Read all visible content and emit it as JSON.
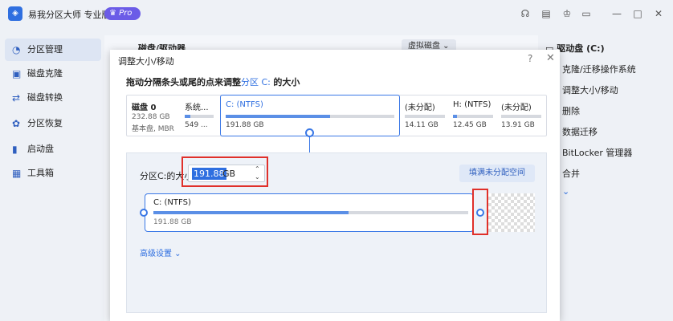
{
  "app": {
    "title": "易我分区大师 专业版",
    "badge": "Pro"
  },
  "sidebar": {
    "items": [
      {
        "label": "分区管理",
        "active": true
      },
      {
        "label": "磁盘克隆"
      },
      {
        "label": "磁盘转换"
      },
      {
        "label": "分区恢复"
      },
      {
        "label": "启动盘"
      },
      {
        "label": "工具箱"
      }
    ]
  },
  "main": {
    "title": "磁盘/驱动器",
    "virtual_disk": "虚拟磁盘"
  },
  "right_panel": {
    "title": "驱动盘 (C:)",
    "items": [
      "克隆/迁移操作系统",
      "调整大小/移动",
      "删除",
      "数据迁移",
      "BitLocker 管理器",
      "合并"
    ]
  },
  "dialog": {
    "title": "调整大小/移动",
    "instruction_prefix": "拖动分隔条头或尾的点来调整",
    "instruction_highlight": "分区 C:",
    "instruction_suffix": "的大小",
    "disk": {
      "name": "磁盘 0",
      "size": "232.88 GB",
      "type": "基本盘, MBR"
    },
    "partitions": [
      {
        "label": "系统...",
        "size": "549 ..."
      },
      {
        "label": "C: (NTFS)",
        "size": "191.88 GB",
        "selected": true
      },
      {
        "label": "(未分配)",
        "size": "14.11 GB"
      },
      {
        "label": "H: (NTFS)",
        "size": "12.45 GB"
      },
      {
        "label": "(未分配)",
        "size": "13.91 GB"
      }
    ],
    "size_label": "分区C:的大小",
    "size_value": "191.88",
    "size_unit": "GB",
    "fill_button": "填满未分配空间",
    "card": {
      "label": "C: (NTFS)",
      "size": "191.88 GB",
      "used_fraction": 0.62
    },
    "advanced": "高级设置"
  }
}
